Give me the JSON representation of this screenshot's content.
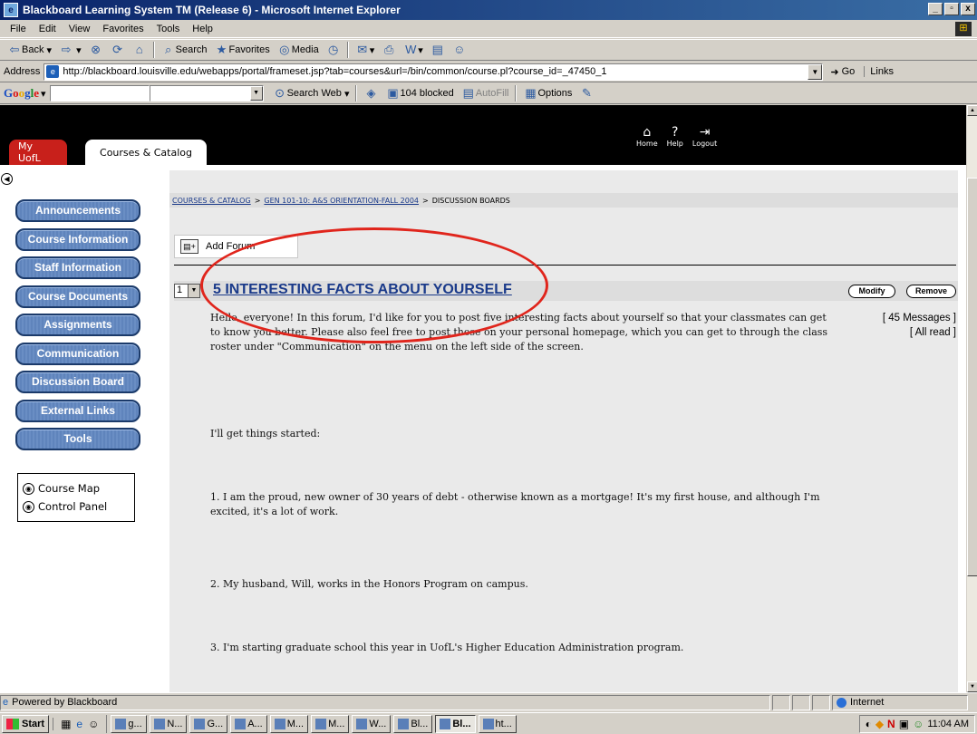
{
  "window": {
    "title": "Blackboard Learning System TM (Release 6) - Microsoft Internet Explorer"
  },
  "menubar": [
    "File",
    "Edit",
    "View",
    "Favorites",
    "Tools",
    "Help"
  ],
  "toolbar": {
    "back": "Back",
    "search": "Search",
    "favorites": "Favorites",
    "media": "Media"
  },
  "address": {
    "label": "Address",
    "url": "http://blackboard.louisville.edu/webapps/portal/frameset.jsp?tab=courses&url=/bin/common/course.pl?course_id=_47450_1",
    "go": "Go",
    "links": "Links"
  },
  "google": {
    "search_web": "Search Web",
    "blocked": "104 blocked",
    "autofill": "AutoFill",
    "options": "Options"
  },
  "bb": {
    "tabs": [
      "My UofL",
      "Courses & Catalog"
    ],
    "tools": [
      "Home",
      "Help",
      "Logout"
    ],
    "nav": [
      "Announcements",
      "Course Information",
      "Staff Information",
      "Course Documents",
      "Assignments",
      "Communication",
      "Discussion Board",
      "External Links",
      "Tools"
    ],
    "toolbox": [
      "Course Map",
      "Control Panel"
    ],
    "breadcrumb": [
      "COURSES & CATALOG",
      "GEN 101-10: A&S ORIENTATION-FALL 2004",
      "DISCUSSION BOARDS"
    ],
    "add_forum": "Add Forum"
  },
  "forum": {
    "order": "1",
    "title": "5 INTERESTING FACTS ABOUT YOURSELF",
    "modify": "Modify",
    "remove": "Remove",
    "messages": "[ 45 Messages ]",
    "read_status": "[ All read ]",
    "paragraphs": [
      "Hello, everyone!  In this forum, I'd like for you to post five interesting facts about yourself so that your classmates can get to know you better.  Please also feel free to post these on your personal homepage, which you can get to through the class roster under \"Communication\" on the menu on the left side of the screen.",
      "I'll get things started:",
      "1. I am the proud, new owner of 30 years of debt - otherwise known as a mortgage!  It's my first house, and although I'm excited, it's a lot of work.",
      "2. My husband, Will, works in the Honors Program on campus.",
      "3. I'm starting graduate school this year in UofL's Higher Education Administration program."
    ]
  },
  "status": {
    "text": "Powered by Blackboard",
    "zone": "Internet"
  },
  "taskbar": {
    "start": "Start",
    "buttons": [
      "g...",
      "N...",
      "G...",
      "A...",
      "M...",
      "M...",
      "W...",
      "Bl...",
      "Bl...",
      "ht..."
    ],
    "active_index": 8,
    "clock": "11:04 AM"
  }
}
